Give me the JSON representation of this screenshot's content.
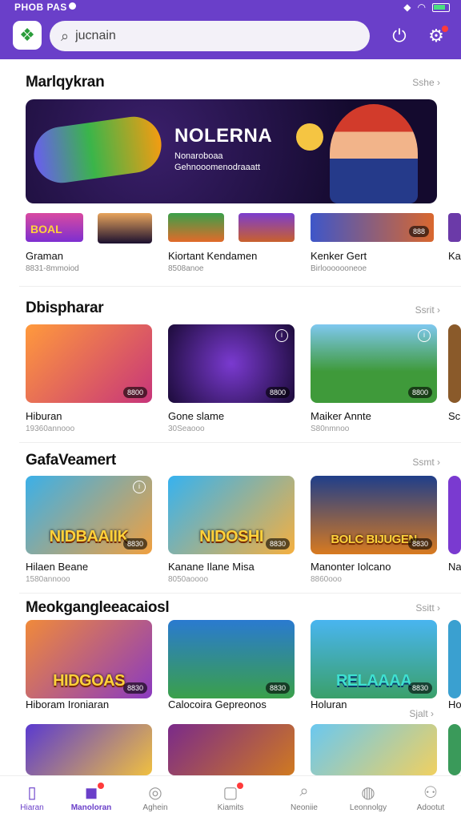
{
  "status": {
    "time": "PHOB PAS",
    "battery_color": "#4ade80"
  },
  "header": {
    "search_value": "jucnain",
    "accent": "#6a3fc9",
    "icons": [
      "app-logo-icon",
      "search-icon",
      "timer-icon",
      "gear-icon"
    ]
  },
  "sections": [
    {
      "title": "Marlqykran",
      "see_all": "Sshe",
      "hero": {
        "title": "NOLERNA",
        "subtitle_1": "Nonaroboaa",
        "subtitle_2": "Gehnooomenodraaatt"
      },
      "minis": [
        {
          "title": "Graman",
          "sub": "8831-8mmoiod",
          "overlay": "BOAL"
        },
        {
          "title": "Kiortant Kendamen",
          "sub": "8508anoe"
        },
        {
          "title": "Kenker Gert",
          "sub": "Birlooooooneoe",
          "price": "888"
        },
        {
          "title": "Ka",
          "sub": ""
        }
      ]
    },
    {
      "title": "Dbispharar",
      "see_all": "Ssrit",
      "cards": [
        {
          "title": "Hiburan",
          "sub": "19360annooo",
          "price": "8800"
        },
        {
          "title": "Gone slame",
          "sub": "30Seaooo",
          "price": "8800"
        },
        {
          "title": "Maiker Annte",
          "sub": "S80nmnoo",
          "price": "8800"
        },
        {
          "title": "Sc",
          "sub": ""
        }
      ]
    },
    {
      "title": "GafaVeamert",
      "see_all": "Ssmt",
      "cards": [
        {
          "title": "Hilaen Beane",
          "sub": "1580annooo",
          "price": "8830",
          "overlay": "NIDBAAIIK"
        },
        {
          "title": "Kanane Ilane Misa",
          "sub": "8050aoooo",
          "price": "8830",
          "overlay": "NIDOSHI"
        },
        {
          "title": "Manonter Iolcano",
          "sub": "8860ooo",
          "price": "8830",
          "overlay": "BOLC BIJUGEN"
        },
        {
          "title": "Na",
          "sub": ""
        }
      ]
    },
    {
      "title": "Meokgangleeacaiosl",
      "see_all": "Ssitt",
      "cards": [
        {
          "title": "Hiboram Ironiaran",
          "sub": "",
          "price": "8830",
          "overlay": "HIDGOAS"
        },
        {
          "title": "Calocoira Gepreonos",
          "sub": "",
          "price": "8830"
        },
        {
          "title": "Holuran",
          "sub": "",
          "price": "8830",
          "overlay": "RELAAAA"
        },
        {
          "title": "Ho",
          "sub": ""
        }
      ],
      "extra_see_all": "Sjalt"
    }
  ],
  "bottom_nav": [
    {
      "label": "Hiaran",
      "icon": "bookmark-icon"
    },
    {
      "label": "Manoloran",
      "icon": "home-icon"
    },
    {
      "label": "Aghein",
      "icon": "compass-icon"
    },
    {
      "label": "Kiamits",
      "icon": "inbox-icon"
    },
    {
      "label": "Neoniie",
      "icon": "search-icon"
    },
    {
      "label": "Leonnolgy",
      "icon": "chat-icon"
    },
    {
      "label": "Adootut",
      "icon": "profile-icon"
    }
  ]
}
